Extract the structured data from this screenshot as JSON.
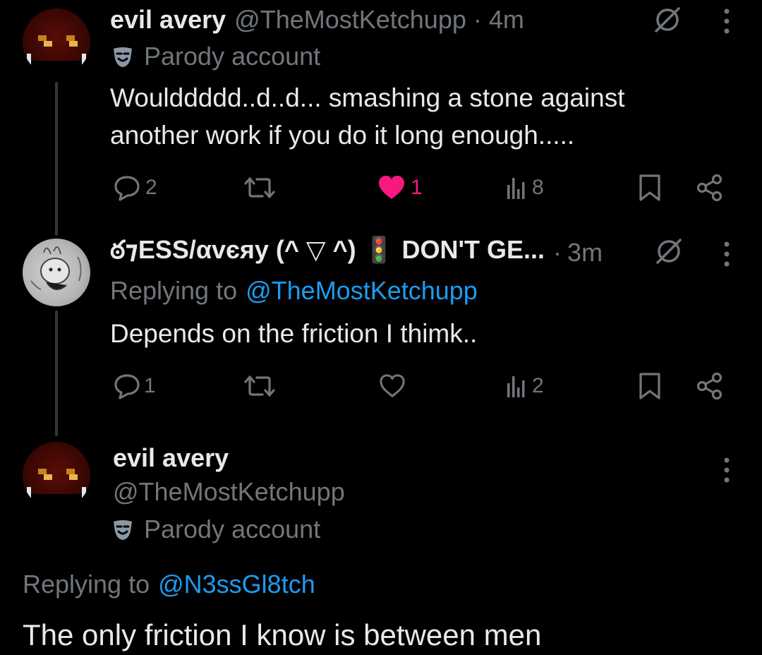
{
  "colors": {
    "background": "#000000",
    "text_primary": "#e7e9ea",
    "text_secondary": "#71767b",
    "link": "#1d9bf0",
    "like_active": "#f91880",
    "thread_line": "#333639"
  },
  "posts": [
    {
      "display_name": "evil avery",
      "handle": "@TheMostKetchupp",
      "separator": "·",
      "time": "4m",
      "label": "Parody account",
      "label_icon": "parody-mask-icon",
      "text_lines": [
        "Woulddddd..d..d... smashing a stone against",
        "another work if you do it long enough....."
      ],
      "actions": {
        "replies": "2",
        "retweets": "",
        "likes": "1",
        "views": "8",
        "liked": true
      },
      "avatar_icon": "pixel-face-avatar"
    },
    {
      "display_name": "ఠ⁊ESS/αvєяy (^ ▽ ^) 🚦 DON'T GE...",
      "separator": "·",
      "time": "3m",
      "replying_prefix": "Replying to",
      "replying_handle": "@TheMostKetchupp",
      "text_lines": [
        "Depends on the friction I thimk.."
      ],
      "actions": {
        "replies": "1",
        "retweets": "",
        "likes": "",
        "views": "2",
        "liked": false
      },
      "avatar_icon": "sketch-character-avatar"
    },
    {
      "display_name": "evil avery",
      "handle": "@TheMostKetchupp",
      "label": "Parody account",
      "label_icon": "parody-mask-icon",
      "replying_prefix": "Replying to",
      "replying_handle": "@N3ssGl8tch",
      "text_lines": [
        "The only friction I know is between men"
      ],
      "avatar_icon": "pixel-face-avatar"
    }
  ]
}
